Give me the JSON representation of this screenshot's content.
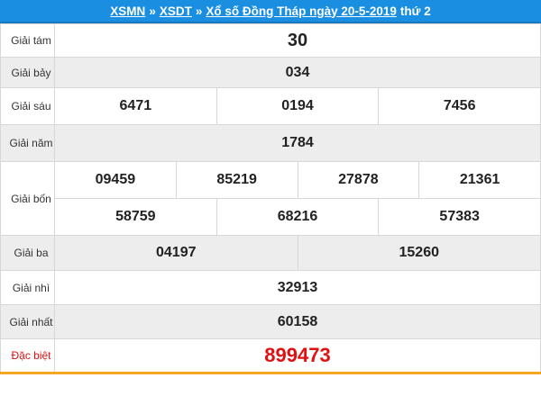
{
  "header": {
    "link_xsmn": "XSMN",
    "sep1": "»",
    "link_xsdt": "XSDT",
    "sep2": "»",
    "link_title": "Xổ số Đồng Tháp ngày 20-5-2019",
    "suffix": "thứ 2"
  },
  "prizes": {
    "tam": {
      "label": "Giải tám",
      "values": [
        "30"
      ]
    },
    "bay": {
      "label": "Giải bảy",
      "values": [
        "034"
      ]
    },
    "sau": {
      "label": "Giải sáu",
      "values": [
        "6471",
        "0194",
        "7456"
      ]
    },
    "nam": {
      "label": "Giải năm",
      "values": [
        "1784"
      ]
    },
    "bon": {
      "label": "Giải bốn",
      "values": [
        "09459",
        "85219",
        "27878",
        "21361",
        "58759",
        "68216",
        "57383"
      ]
    },
    "ba": {
      "label": "Giải ba",
      "values": [
        "04197",
        "15260"
      ]
    },
    "nhi": {
      "label": "Giải nhì",
      "values": [
        "32913"
      ]
    },
    "nhat": {
      "label": "Giải nhất",
      "values": [
        "60158"
      ]
    },
    "dacbiet": {
      "label": "Đặc biệt",
      "values": [
        "899473"
      ]
    }
  },
  "colors": {
    "header_bg": "#1a8ee0",
    "special": "#e01010",
    "row_shade": "#ededed",
    "bottom_accent": "#f5a623"
  }
}
